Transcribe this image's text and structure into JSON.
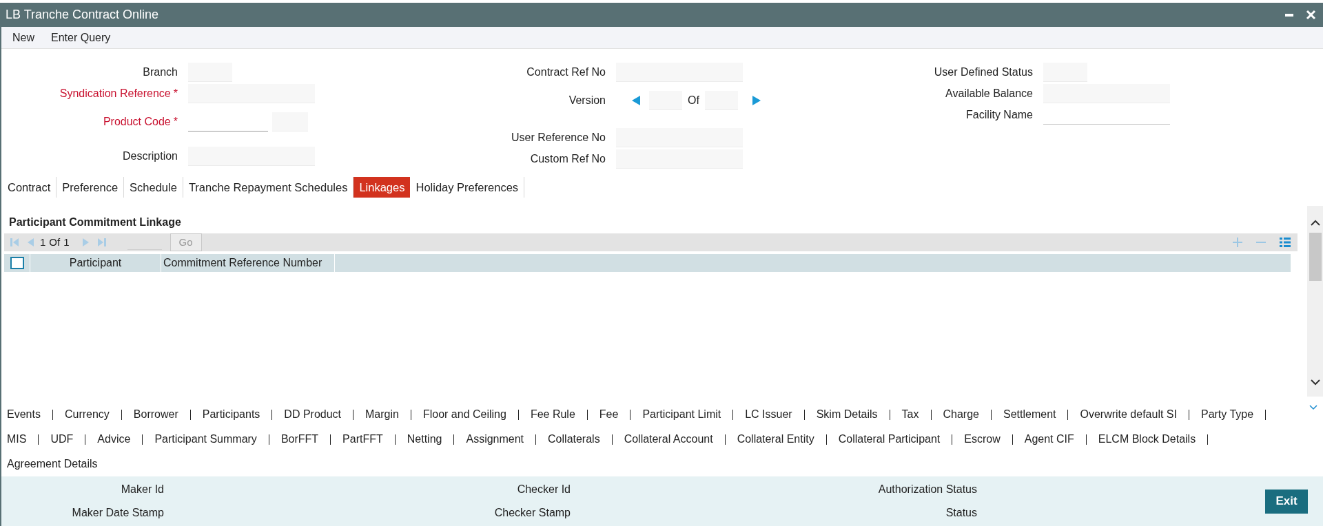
{
  "window": {
    "title": "LB Tranche Contract Online"
  },
  "toolbar": [
    "New",
    "Enter Query"
  ],
  "form": {
    "left": [
      {
        "label": "Branch",
        "required": false,
        "kind": "short"
      },
      {
        "label": "Syndication Reference",
        "required": true,
        "mark": "*",
        "kind": "wide"
      },
      {
        "label": "Product Code",
        "required": true,
        "mark": "*",
        "kind": "code"
      },
      {
        "label": "Description",
        "required": false,
        "kind": "wide"
      }
    ],
    "middle": [
      {
        "label": "Contract Ref No",
        "required": false,
        "kind": "wide"
      },
      {
        "label": "Version",
        "required": false,
        "kind": "version",
        "of": "Of"
      },
      {
        "label": "User Reference No",
        "required": false,
        "kind": "wide"
      },
      {
        "label": "Custom Ref No",
        "required": false,
        "kind": "wide"
      }
    ],
    "right": [
      {
        "label": "User Defined Status",
        "required": false,
        "kind": "short"
      },
      {
        "label": "Available Balance",
        "required": false,
        "kind": "wide"
      },
      {
        "label": "Facility Name",
        "required": false,
        "kind": "underline"
      }
    ]
  },
  "tabs": [
    {
      "label": "Contract",
      "selected": false
    },
    {
      "label": "Preference",
      "selected": false
    },
    {
      "label": "Schedule",
      "selected": false
    },
    {
      "label": "Tranche Repayment Schedules",
      "selected": false
    },
    {
      "label": "Linkages",
      "selected": true
    },
    {
      "label": "Holiday Preferences",
      "selected": false
    }
  ],
  "section": {
    "title": "Participant Commitment Linkage",
    "pager": {
      "current": "1",
      "of": "Of",
      "total": "1",
      "go": "Go"
    },
    "select_all": {
      "checked": false
    },
    "columns": [
      "Participant",
      "Commitment Reference Number"
    ]
  },
  "links": [
    [
      "Events",
      "Currency",
      "Borrower",
      "Participants",
      "DD Product",
      "Margin",
      "Floor and Ceiling",
      "Fee Rule",
      "Fee",
      "Participant Limit",
      "LC Issuer",
      "Skim Details",
      "Tax",
      "Charge",
      "Settlement",
      "Overwrite default SI",
      "Party Type"
    ],
    [
      "MIS",
      "UDF",
      "Advice",
      "Participant Summary",
      "BorFFT",
      "PartFFT",
      "Netting",
      "Assignment",
      "Collaterals",
      "Collateral Account",
      "Collateral Entity",
      "Collateral Participant",
      "Escrow",
      "Agent CIF",
      "ELCM Block Details"
    ],
    [
      "Agreement Details"
    ]
  ],
  "footer": {
    "columns": [
      [
        "Maker Id",
        "Maker Date Stamp"
      ],
      [
        "Checker Id",
        "Checker Stamp"
      ],
      [
        "Authorization Status",
        "Status"
      ]
    ],
    "exit": "Exit"
  }
}
